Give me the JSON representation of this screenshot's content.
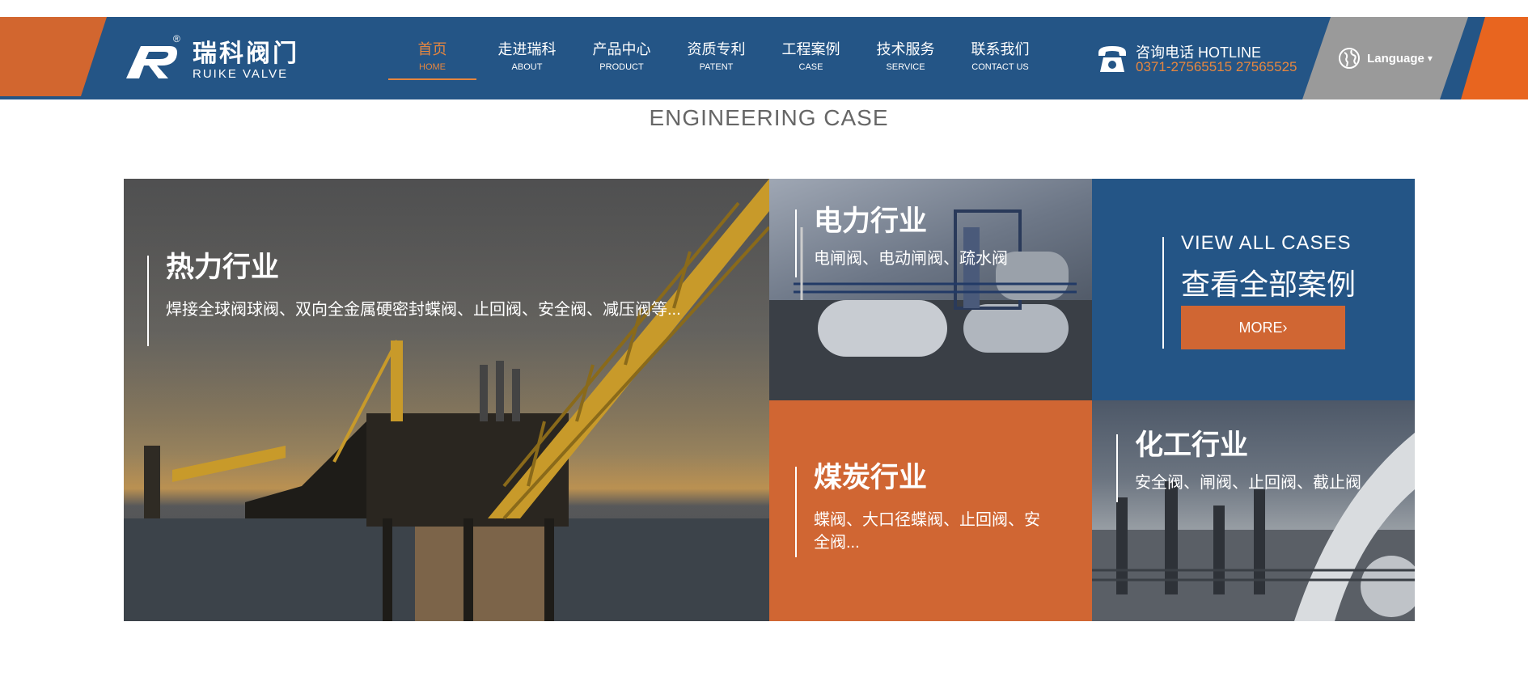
{
  "header": {
    "logo": {
      "cn": "瑞科阀门",
      "en": "RUIKE VALVE",
      "mark": "®"
    },
    "nav": [
      {
        "cn": "首页",
        "en": "HOME",
        "active": true
      },
      {
        "cn": "走进瑞科",
        "en": "ABOUT"
      },
      {
        "cn": "产品中心",
        "en": "PRODUCT"
      },
      {
        "cn": "资质专利",
        "en": "PATENT"
      },
      {
        "cn": "工程案例",
        "en": "CASE"
      },
      {
        "cn": "技术服务",
        "en": "SERVICE"
      },
      {
        "cn": "联系我们",
        "en": "CONTACT US"
      }
    ],
    "hotline": {
      "label": "咨询电话 HOTLINE",
      "numbers": "0371-27565515 27565525"
    },
    "language": "Language"
  },
  "section": {
    "title_en": "ENGINEERING CASE"
  },
  "cases": {
    "heat": {
      "title": "热力行业",
      "desc": "焊接全球阀球阀、双向全金属硬密封蝶阀、止回阀、安全阀、减压阀等..."
    },
    "power": {
      "title": "电力行业",
      "desc": "电闸阀、电动闸阀、疏水阀"
    },
    "coal": {
      "title": "煤炭行业",
      "desc": "蝶阀、大口径蝶阀、止回阀、安全阀..."
    },
    "chem": {
      "title": "化工行业",
      "desc": "安全阀、闸阀、止回阀、截止阀"
    },
    "all": {
      "title_en": "VIEW ALL CASES",
      "title_cn": "查看全部案例",
      "more": "MORE"
    }
  },
  "colors": {
    "navy": "#245586",
    "orange": "#d06633",
    "accent": "#e6863f"
  }
}
